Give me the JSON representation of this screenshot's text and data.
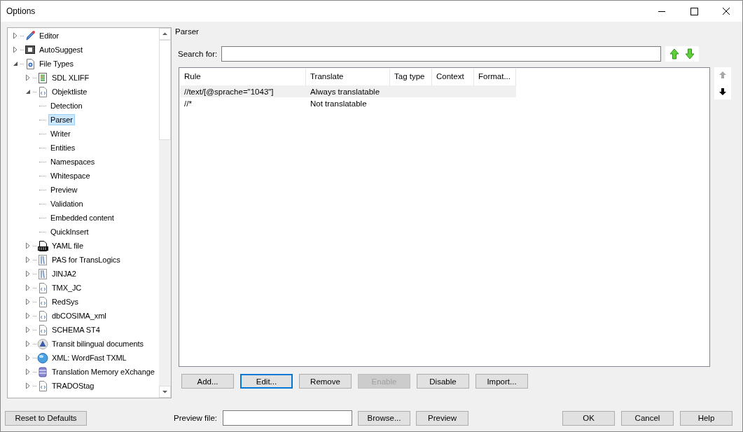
{
  "window": {
    "title": "Options"
  },
  "tree": {
    "items": [
      {
        "label": "Editor",
        "kind": "pencil",
        "expanded": false,
        "selected": false
      },
      {
        "label": "AutoSuggest",
        "kind": "keyboard",
        "expanded": false,
        "selected": false
      },
      {
        "label": "File Types",
        "kind": "gear",
        "expanded": true,
        "selected": false,
        "children": [
          {
            "label": "SDL XLIFF",
            "kind": "list",
            "expanded": false,
            "selected": false
          },
          {
            "label": "Objektliste",
            "kind": "code",
            "expanded": true,
            "selected": false,
            "children": [
              {
                "label": "Detection",
                "kind": "leaf",
                "selected": false
              },
              {
                "label": "Parser",
                "kind": "leaf",
                "selected": true
              },
              {
                "label": "Writer",
                "kind": "leaf",
                "selected": false
              },
              {
                "label": "Entities",
                "kind": "leaf",
                "selected": false
              },
              {
                "label": "Namespaces",
                "kind": "leaf",
                "selected": false
              },
              {
                "label": "Whitespace",
                "kind": "leaf",
                "selected": false
              },
              {
                "label": "Preview",
                "kind": "leaf",
                "selected": false
              },
              {
                "label": "Validation",
                "kind": "leaf",
                "selected": false
              },
              {
                "label": "Embedded content",
                "kind": "leaf",
                "selected": false
              },
              {
                "label": "QuickInsert",
                "kind": "leaf",
                "selected": false
              }
            ]
          },
          {
            "label": "YAML file",
            "kind": "yaml",
            "expanded": false,
            "selected": false
          },
          {
            "label": "PAS for TransLogics",
            "kind": "book",
            "expanded": false,
            "selected": false
          },
          {
            "label": "JINJA2",
            "kind": "book",
            "expanded": false,
            "selected": false
          },
          {
            "label": "TMX_JC",
            "kind": "code",
            "expanded": false,
            "selected": false
          },
          {
            "label": "RedSys",
            "kind": "code",
            "expanded": false,
            "selected": false
          },
          {
            "label": "dbCOSIMA_xml",
            "kind": "code",
            "expanded": false,
            "selected": false
          },
          {
            "label": "SCHEMA ST4",
            "kind": "code",
            "expanded": false,
            "selected": false
          },
          {
            "label": "Transit bilingual documents",
            "kind": "triangle",
            "expanded": false,
            "selected": false
          },
          {
            "label": "XML: WordFast TXML",
            "kind": "globe",
            "expanded": false,
            "selected": false
          },
          {
            "label": "Translation Memory eXchange",
            "kind": "database",
            "expanded": false,
            "selected": false
          },
          {
            "label": "TRADOStag",
            "kind": "code",
            "expanded": false,
            "selected": false
          }
        ]
      }
    ]
  },
  "group": {
    "title": "Parser"
  },
  "search": {
    "label": "Search for:"
  },
  "table": {
    "columns": [
      "Rule",
      "Translate",
      "Tag type",
      "Context",
      "Format..."
    ],
    "rows": [
      {
        "cells": [
          "//text/[@sprache=\"1043\"]",
          "Always translatable"
        ],
        "selected": true
      },
      {
        "cells": [
          "//*",
          "Not translatable"
        ],
        "selected": false
      }
    ]
  },
  "buttons": [
    {
      "label": "Add...",
      "disabled": false,
      "focused": false
    },
    {
      "label": "Edit...",
      "disabled": false,
      "focused": true
    },
    {
      "label": "Remove",
      "disabled": false,
      "focused": false
    },
    {
      "label": "Enable",
      "disabled": true,
      "focused": false
    },
    {
      "label": "Disable",
      "disabled": false,
      "focused": false
    },
    {
      "label": "Import...",
      "disabled": false,
      "focused": false
    }
  ],
  "footer": {
    "reset": "Reset to Defaults",
    "preview_label": "Preview file:",
    "browse": "Browse...",
    "preview": "Preview",
    "ok": "OK",
    "cancel": "Cancel",
    "help": "Help"
  }
}
